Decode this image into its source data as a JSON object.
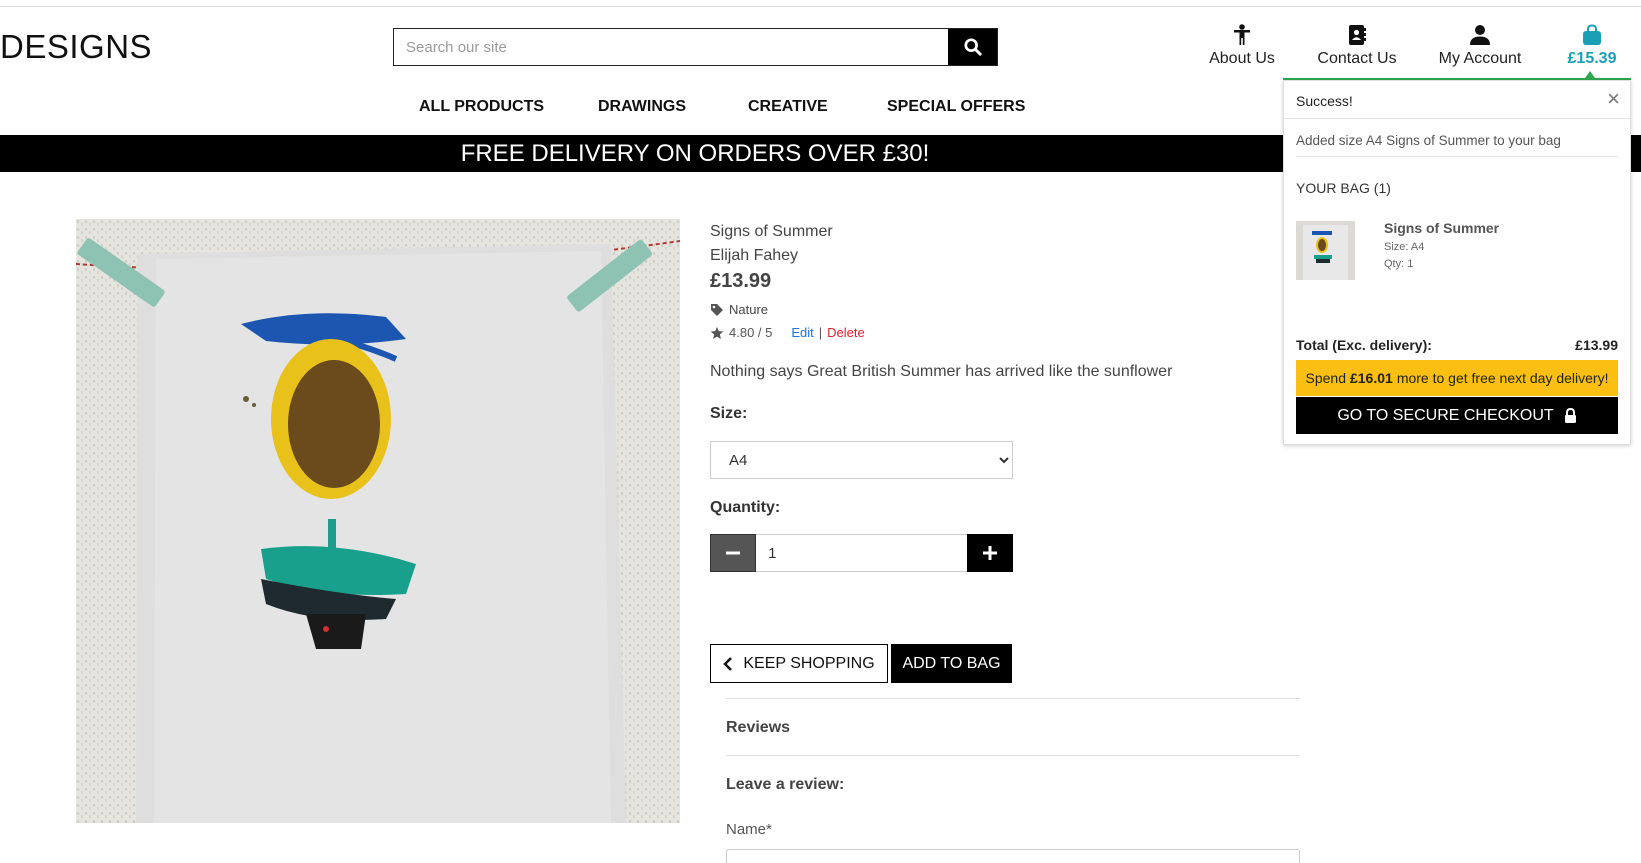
{
  "header": {
    "logo_text": "DESIGNS",
    "search": {
      "placeholder": "Search our site",
      "value": ""
    },
    "nav_icons": [
      {
        "label": "About Us",
        "icon": "person-icon"
      },
      {
        "label": "Contact Us",
        "icon": "address-book-icon"
      },
      {
        "label": "My Account",
        "icon": "user-icon"
      }
    ],
    "bag": {
      "total": "£15.39",
      "icon": "shopping-bag-icon",
      "color": "#1a9fb5"
    },
    "main_nav": [
      "ALL PRODUCTS",
      "DRAWINGS",
      "CREATIVE",
      "SPECIAL OFFERS"
    ]
  },
  "banner": {
    "text": "FREE DELIVERY ON ORDERS OVER £30!"
  },
  "product": {
    "name": "Signs of Summer",
    "artist": "Elijah Fahey",
    "price": "£13.99",
    "category": "Nature",
    "rating": "4.80 / 5",
    "edit_label": "Edit",
    "separator": "|",
    "delete_label": "Delete",
    "description": "Nothing says Great British Summer has arrived like the sunflower",
    "size_label": "Size:",
    "size_options": [
      "A4"
    ],
    "size_selected": "A4",
    "quantity_label": "Quantity:",
    "quantity": "1",
    "keep_shopping_label": "KEEP SHOPPING",
    "add_to_bag_label": "ADD TO BAG"
  },
  "reviews": {
    "heading": "Reviews",
    "leave_heading": "Leave a review:",
    "name_label": "Name*"
  },
  "toast": {
    "title": "Success!",
    "close": "×",
    "message": "Added size A4 Signs of Summer to your bag",
    "bag_label": "YOUR BAG (1)",
    "item": {
      "name": "Signs of Summer",
      "size": "Size: A4",
      "qty": "Qty: 1"
    },
    "total_label": "Total (Exc. delivery):",
    "total_value": "£13.99",
    "spend_prefix": "Spend",
    "spend_amount": "£16.01",
    "spend_suffix": "more to get free next day delivery!",
    "checkout_label": "GO TO SECURE CHECKOUT",
    "accent_color": "#2fa84f",
    "warning_color": "#fbbf14"
  }
}
